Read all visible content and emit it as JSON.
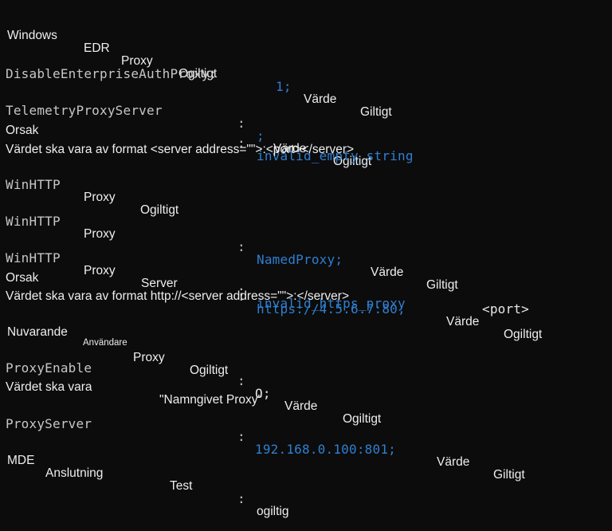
{
  "console": {
    "background_color": "#0c0c0c",
    "text_color": "#eeeeee",
    "value_color": "#2f7fd0",
    "key_color": "#c6c6c6"
  },
  "sections": {
    "edr": {
      "title_a": "Windows",
      "title_b": "EDR",
      "title_c": "Proxy",
      "status": "Ogiltigt"
    },
    "winhttp": {
      "title_a": "WinHTTP",
      "title_b": "Proxy",
      "status": "Ogiltigt"
    },
    "user": {
      "title_a": "Nuvarande",
      "title_b": "Användare",
      "title_c": "Proxy",
      "status": "Ogiltigt"
    }
  },
  "entries": {
    "disable_enterprise_auth_proxy": {
      "key": "DisableEnterpriseAuthProxy:",
      "value": "1;",
      "label": "Värde",
      "status": "Giltigt"
    },
    "telemetry_proxy_server": {
      "key": "TelemetryProxyServer",
      "colon": ":",
      "value": ";",
      "label": "Värde",
      "status": "Ogiltigt",
      "reason_label": "Orsak",
      "reason_colon": ":",
      "reason_value": "invalid_empty_string",
      "hint": "Värdet ska vara av format <server address=\"\">:<port></server>"
    },
    "winhttp_proxy": {
      "key_a": "WinHTTP",
      "key_b": "Proxy",
      "colon": ":",
      "value": "NamedProxy;",
      "label": "Värde",
      "status": "Giltigt"
    },
    "winhttp_proxy_server": {
      "key_a": "WinHTTP",
      "key_b": "Proxy",
      "key_c": "Server",
      "colon": ":",
      "value": "https://4.5.6.7:80;",
      "label": "Värde",
      "status": "Ogiltigt",
      "reason_label": "Orsak",
      "reason_colon": ":",
      "reason_value": "invalid_https_proxy",
      "hint": "Värdet ska vara av format http://<server address=\"\">:</server>",
      "hint_suffix": "<port>"
    },
    "proxy_enable": {
      "key": "ProxyEnable",
      "colon": ":",
      "value": "O;",
      "label": "Värde",
      "status": "Ogiltigt",
      "hint_label": "Värdet ska vara",
      "hint_value": "\"Namngivet Proxy\""
    },
    "proxy_server": {
      "key": "ProxyServer",
      "colon": ":",
      "value": "192.168.0.100:801;",
      "label": "Värde",
      "status": "Giltigt"
    },
    "mde_connection_test": {
      "key_a": "MDE",
      "key_b": "Anslutning",
      "key_c": "Test",
      "colon": ":",
      "value": "ogiltig"
    }
  }
}
